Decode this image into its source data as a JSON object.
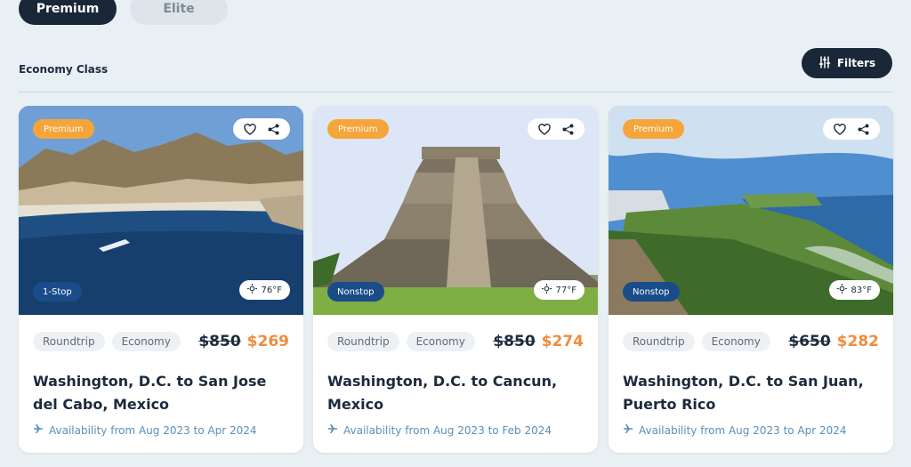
{
  "tabs": [
    {
      "label": "Premium",
      "active": true
    },
    {
      "label": "Elite",
      "active": false
    }
  ],
  "section": {
    "title": "Economy Class"
  },
  "filters": {
    "label": "Filters"
  },
  "cards": [
    {
      "badge": "Premium",
      "stops": "1-Stop",
      "temperature": "76°F",
      "trip_type": "Roundtrip",
      "cabin": "Economy",
      "old_price": "$850",
      "new_price": "$269",
      "route": "Washington, D.C. to San Jose del Cabo, Mexico",
      "availability": "Availability from Aug 2023 to Apr 2024"
    },
    {
      "badge": "Premium",
      "stops": "Nonstop",
      "temperature": "77°F",
      "trip_type": "Roundtrip",
      "cabin": "Economy",
      "old_price": "$850",
      "new_price": "$274",
      "route": "Washington, D.C. to Cancun, Mexico",
      "availability": "Availability from Aug 2023 to Feb 2024"
    },
    {
      "badge": "Premium",
      "stops": "Nonstop",
      "temperature": "83°F",
      "trip_type": "Roundtrip",
      "cabin": "Economy",
      "old_price": "$650",
      "new_price": "$282",
      "route": "Washington, D.C. to San Juan, Puerto Rico",
      "availability": "Availability from Aug 2023 to Apr 2024"
    }
  ],
  "colors": {
    "dark": "#1a2739",
    "accent_orange": "#f08c3c",
    "badge_blue": "#1a4c8a",
    "premium_badge": "#f5a53a"
  }
}
